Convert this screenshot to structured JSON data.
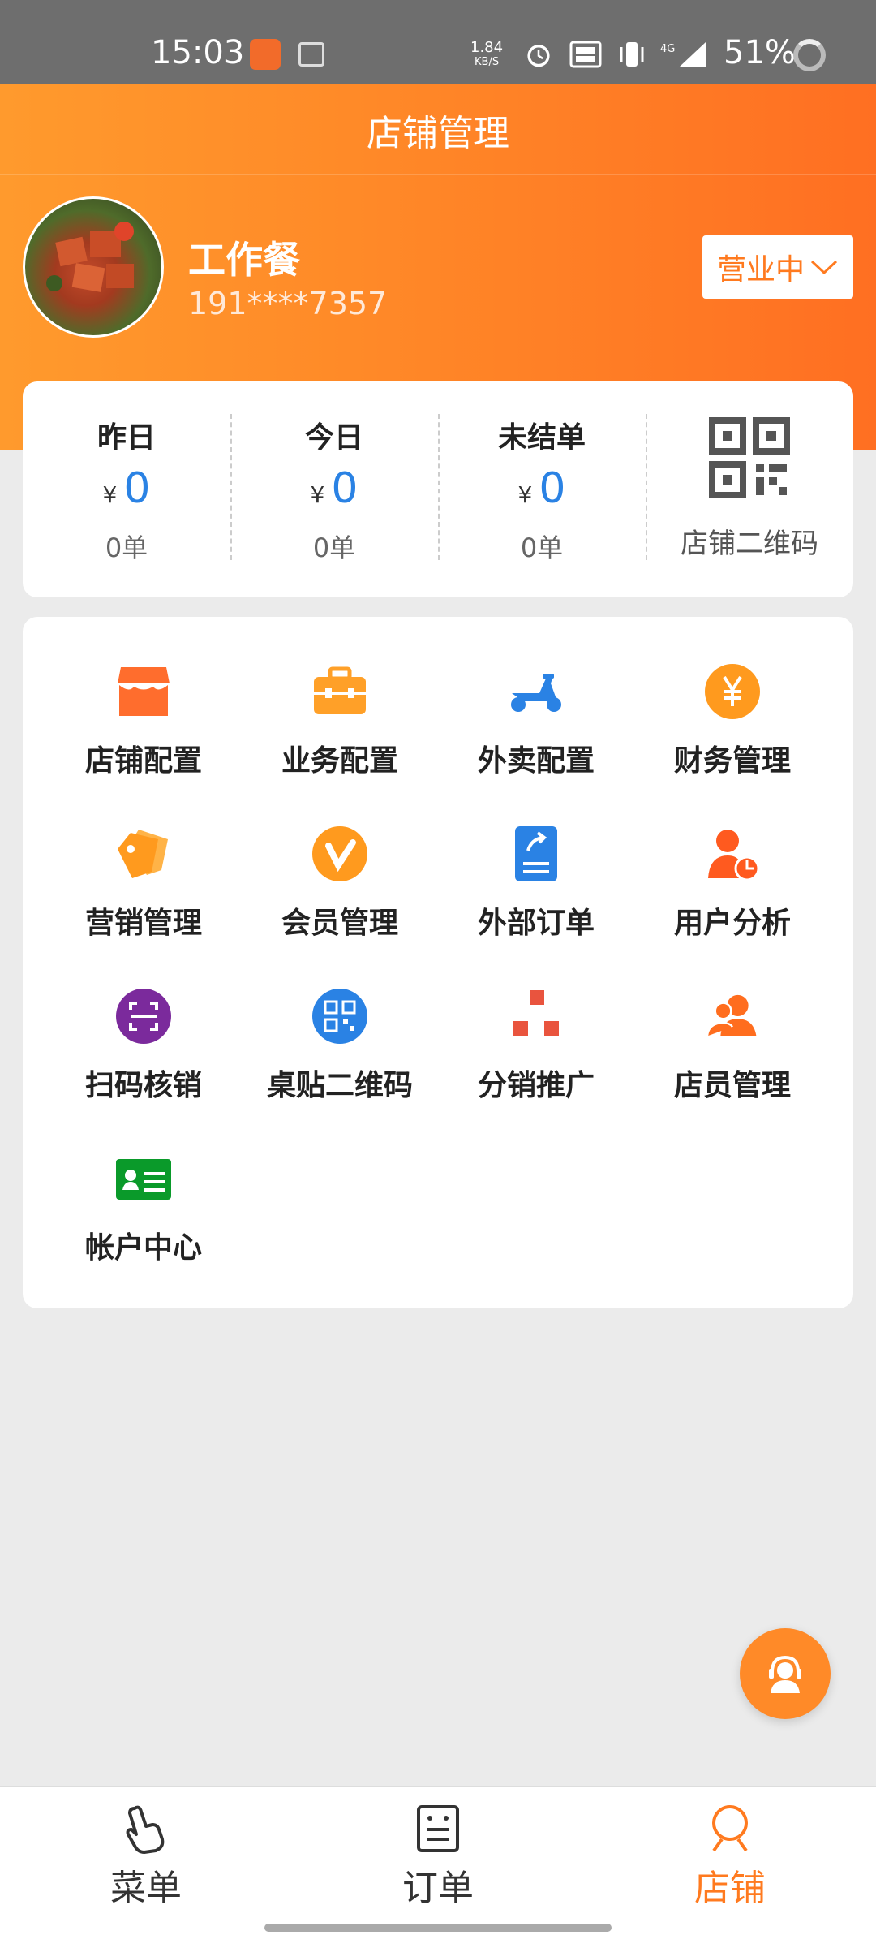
{
  "status_bar": {
    "time": "15:03",
    "net_rate": "1.84",
    "net_unit": "KB/S",
    "network": "4G",
    "battery": "51%"
  },
  "header": {
    "title": "店铺管理",
    "store_name": "工作餐",
    "phone": "191****7357",
    "status": "营业中"
  },
  "stats": [
    {
      "label": "昨日",
      "currency": "¥",
      "value": "0",
      "orders": "0单"
    },
    {
      "label": "今日",
      "currency": "¥",
      "value": "0",
      "orders": "0单"
    },
    {
      "label": "未结单",
      "currency": "¥",
      "value": "0",
      "orders": "0单"
    }
  ],
  "qr": {
    "label": "店铺二维码"
  },
  "menu": [
    {
      "label": "店铺配置",
      "icon": "store-icon"
    },
    {
      "label": "业务配置",
      "icon": "briefcase-icon"
    },
    {
      "label": "外卖配置",
      "icon": "scooter-icon"
    },
    {
      "label": "财务管理",
      "icon": "yen-icon"
    },
    {
      "label": "营销管理",
      "icon": "tag-icon"
    },
    {
      "label": "会员管理",
      "icon": "vip-icon"
    },
    {
      "label": "外部订单",
      "icon": "external-order-icon"
    },
    {
      "label": "用户分析",
      "icon": "user-analysis-icon"
    },
    {
      "label": "扫码核销",
      "icon": "scan-icon"
    },
    {
      "label": "桌贴二维码",
      "icon": "table-qr-icon"
    },
    {
      "label": "分销推广",
      "icon": "distribution-icon"
    },
    {
      "label": "店员管理",
      "icon": "staff-icon"
    },
    {
      "label": "帐户中心",
      "icon": "account-card-icon"
    }
  ],
  "nav": [
    {
      "label": "菜单",
      "icon": "hand-pointer-icon",
      "active": false
    },
    {
      "label": "订单",
      "icon": "order-list-icon",
      "active": false
    },
    {
      "label": "店铺",
      "icon": "store-user-icon",
      "active": true
    }
  ],
  "colors": {
    "accent": "#ff7a1f",
    "header_start": "#ff9a2d",
    "header_end": "#ff6f22",
    "value_blue": "#2a82e4",
    "background": "#ebebeb"
  }
}
